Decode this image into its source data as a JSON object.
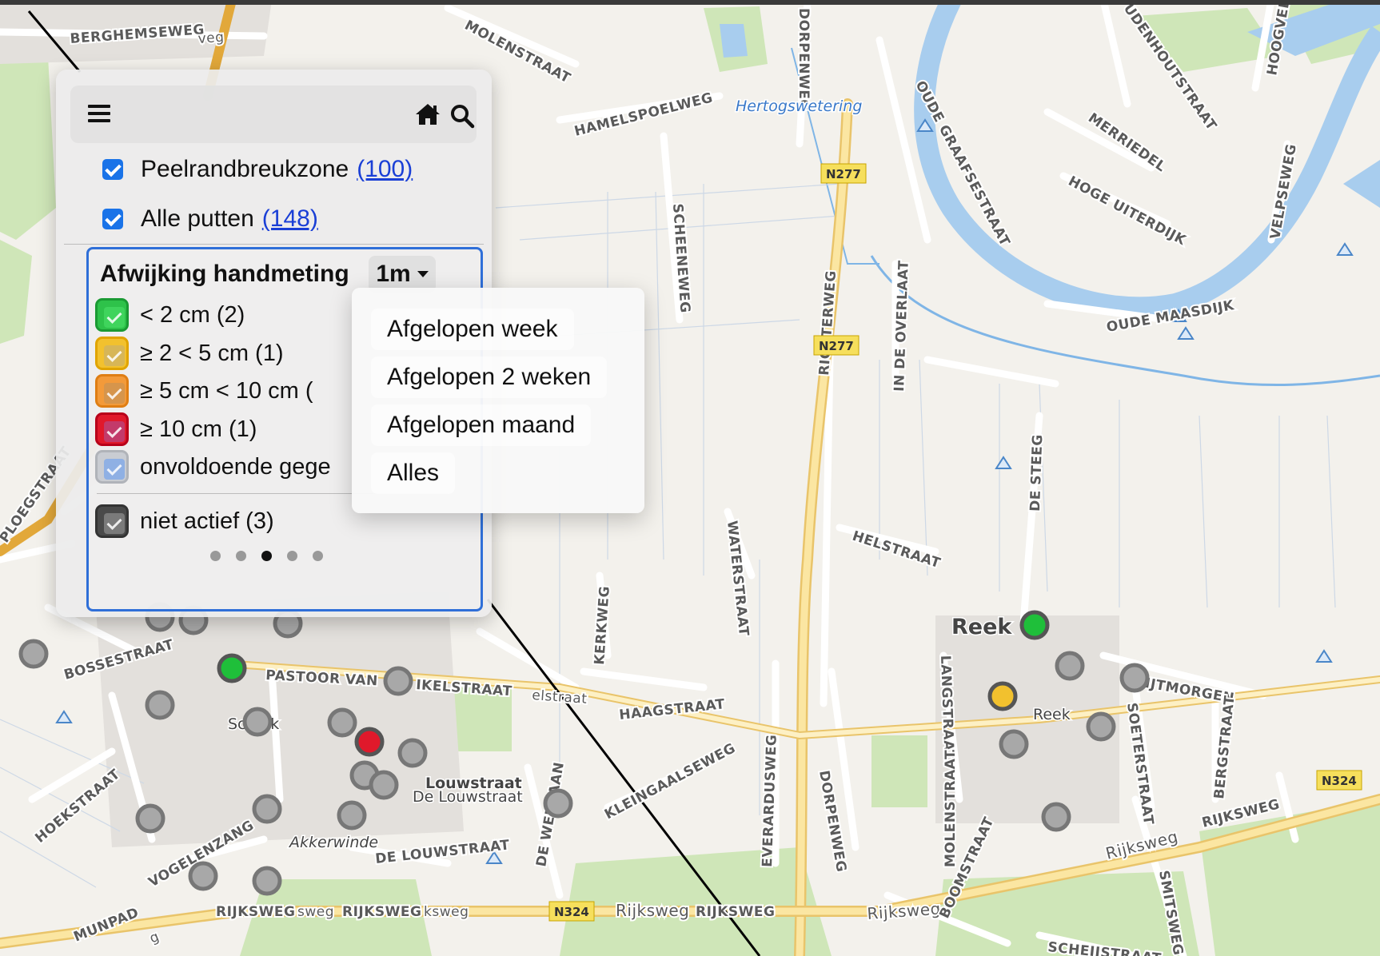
{
  "map": {
    "road_labels": [
      "BERGHEMSEWEG",
      "MOLENSTRAAT",
      "HAMELSPOELWEG",
      "DORPENWEG",
      "OUDE GRAAFSESTRAAT",
      "UDENHOUTSTRAAT",
      "MERRIEDEL",
      "HOGE UITERDIJK",
      "HOOGVELDS",
      "VELPSEWEG",
      "SCHEENEWEG",
      "RICHTERWEG",
      "IN DE OVERLAAT",
      "OUDE MAASDIJK",
      "DE STEEG",
      "HELSTRAAT",
      "WATERSTRAAT",
      "KERKWEG",
      "PASTOOR VAN",
      "IKELSTRAAT",
      "BOSSESTRAAT",
      "HAAGSTRAAT",
      "HEIJTMORGEN",
      "LANGSTRAAT",
      "SOETERSTRAAT",
      "BERGSTRAAT",
      "MOLENSTRAAT",
      "EVERARDUSWEG",
      "DORPENWEG",
      "KLEINGAALSEWEG",
      "DE LOUWSTRAAT",
      "RIJKSWEG",
      "RIJKSWEG",
      "RIJKSWEG",
      "RIJKSWEG",
      "MUNPAD",
      "HOEKSTRAAT",
      "VOGELENZANG",
      "PLOEGSTRAAT",
      "SMITSWEG",
      "SCHEIJSTRAAT",
      "DE WENLAAN",
      "BOOMSTRAAT"
    ],
    "road_label_extras": [
      "Rijksweg",
      "Rijksweg",
      "Rijksweg",
      "elstraat",
      "sweg",
      "ksweg",
      "g",
      "veg"
    ],
    "place_labels": [
      "Reek",
      "Schaijk",
      "Louwstraat",
      "De Louwstraat",
      "Akkerwinde"
    ],
    "place_label_extras": [
      "Reek",
      "Sc",
      "ik"
    ],
    "water_label": "Hertogswetering",
    "shields": [
      "N277",
      "N277",
      "N324",
      "N324"
    ],
    "well_colors": {
      "green": "#1fbf3a",
      "yellow": "#f2c12e",
      "red": "#e0192b",
      "grey": "#a8a8a8"
    }
  },
  "panel": {
    "layers": [
      {
        "label": "Peelrandbreukzone",
        "count": "(100)",
        "checked": true
      },
      {
        "label": "Alle putten",
        "count": "(148)",
        "checked": true
      }
    ],
    "legend": {
      "title": "Afwijking handmeting",
      "period": "1m",
      "classes": [
        {
          "label": "< 2 cm (2)",
          "color": "#2ec24a"
        },
        {
          "label": "≥ 2 < 5 cm (1)",
          "color": "#f2c12e"
        },
        {
          "label": "≥ 5 cm < 10 cm (",
          "color": "#f39a3a"
        },
        {
          "label": "≥ 10 cm (1)",
          "color": "#e0192b"
        },
        {
          "label": "onvoldoende gege",
          "color": "#9fb4d6"
        }
      ],
      "inactive": {
        "label": "niet actief (3)",
        "color": "#6f6f6f"
      },
      "pages": 5,
      "active_page": 3
    },
    "period_options": [
      "Afgelopen week",
      "Afgelopen 2 weken",
      "Afgelopen maand",
      "Alles"
    ]
  }
}
